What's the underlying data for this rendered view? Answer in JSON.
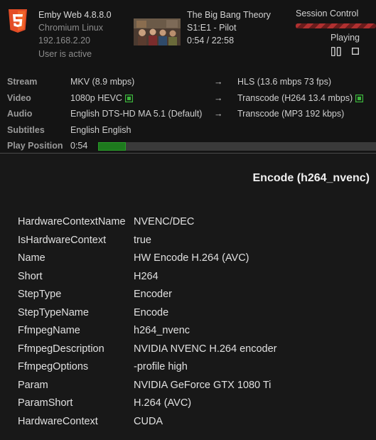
{
  "client": {
    "app": "Emby Web 4.8.8.0",
    "os": "Chromium Linux",
    "ip": "192.168.2.20",
    "status": "User is active",
    "icon": "html5-icon"
  },
  "media": {
    "title": "The Big Bang Theory",
    "episode": "S1:E1 - Pilot",
    "time": "0:54 / 22:58"
  },
  "session": {
    "title": "Session Control",
    "state": "Playing"
  },
  "stats": {
    "rows": [
      {
        "label": "Stream",
        "source": "MKV (8.9 mbps)",
        "arrow": "→",
        "target": "HLS (13.6 mbps 73 fps)"
      },
      {
        "label": "Video",
        "source": "1080p HEVC",
        "arrow": "→",
        "target": "Transcode (H264 13.4 mbps)"
      },
      {
        "label": "Audio",
        "source": "English DTS-HD MA 5.1 (Default)",
        "arrow": "→",
        "target": "Transcode (MP3 192 kbps)"
      },
      {
        "label": "Subtitles",
        "source": "English English"
      },
      {
        "label": "Play Position",
        "source": "0:54"
      }
    ],
    "progress_fraction": 0.099
  },
  "encode": {
    "title": "Encode (h264_nvenc)",
    "properties": [
      {
        "key": "HardwareContextName",
        "value": "NVENC/DEC"
      },
      {
        "key": "IsHardwareContext",
        "value": "true"
      },
      {
        "key": "Name",
        "value": "HW Encode H.264 (AVC)"
      },
      {
        "key": "Short",
        "value": "H264"
      },
      {
        "key": "StepType",
        "value": "Encoder"
      },
      {
        "key": "StepTypeName",
        "value": "Encode"
      },
      {
        "key": "FfmpegName",
        "value": "h264_nvenc"
      },
      {
        "key": "FfmpegDescription",
        "value": "NVIDIA NVENC H.264 encoder"
      },
      {
        "key": "FfmpegOptions",
        "value": "-profile high"
      },
      {
        "key": "Param",
        "value": "NVIDIA GeForce GTX 1080 Ti"
      },
      {
        "key": "ParamShort",
        "value": "H.264 (AVC)"
      },
      {
        "key": "HardwareContext",
        "value": "CUDA"
      }
    ]
  },
  "colors": {
    "background": "#181818",
    "progress": "#1e7a1e",
    "session_bar": "#b03030",
    "html5_orange": "#e44d26"
  }
}
